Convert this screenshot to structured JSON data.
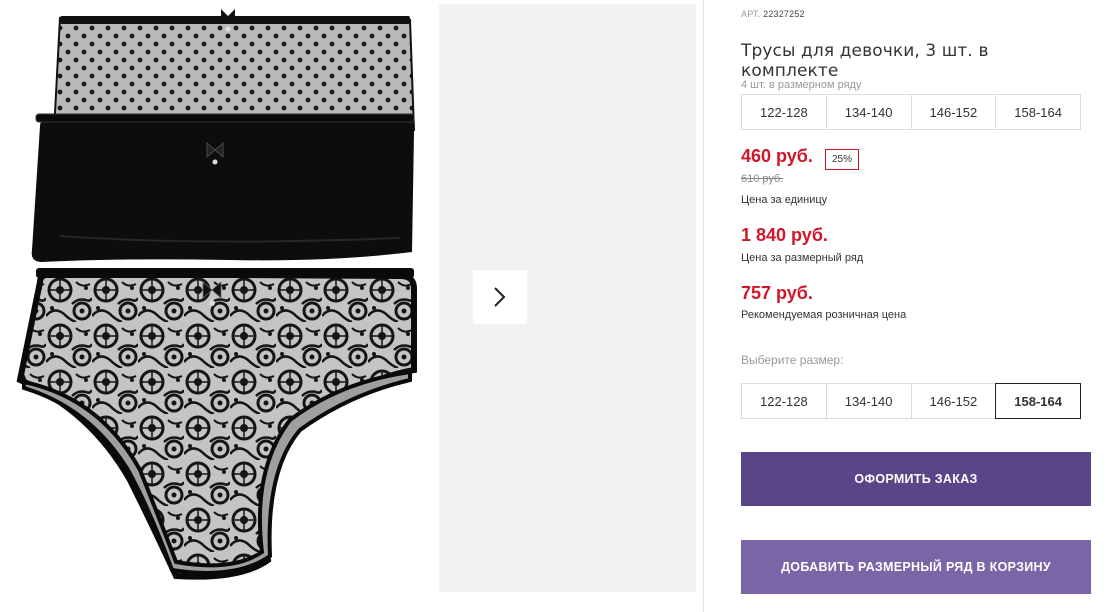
{
  "product": {
    "art_label": "АРТ.",
    "art_number": "22327252",
    "title": "Трусы для девочки, 3 шт. в комплекте",
    "row_note": "4 шт. в размерном ряду",
    "row_sizes": [
      "122-128",
      "134-140",
      "146-152",
      "158-164"
    ]
  },
  "pricing": {
    "unit_price": "460 руб.",
    "discount": "25%",
    "old_price": "610 руб.",
    "unit_caption": "Цена за единицу",
    "row_price": "1 840 руб.",
    "row_caption": "Цена за размерный ряд",
    "rrp": "757 руб.",
    "rrp_caption": "Рекомендуемая розничная цена"
  },
  "size_picker": {
    "label": "Выберите размер:",
    "options": [
      "122-128",
      "134-140",
      "146-152",
      "158-164"
    ],
    "selected": "158-164"
  },
  "actions": {
    "order": "ОФОРМИТЬ ЗАКАЗ",
    "add_row": "ДОБАВИТЬ РАЗМЕРНЫЙ РЯД В КОРЗИНУ"
  },
  "gallery": {
    "next_icon": "chevron-right-icon"
  },
  "colors": {
    "price_red": "#d0172a",
    "order_button": "#5b4589",
    "cart_button": "#7a65a6",
    "panel_bg": "#f2f2f2"
  }
}
